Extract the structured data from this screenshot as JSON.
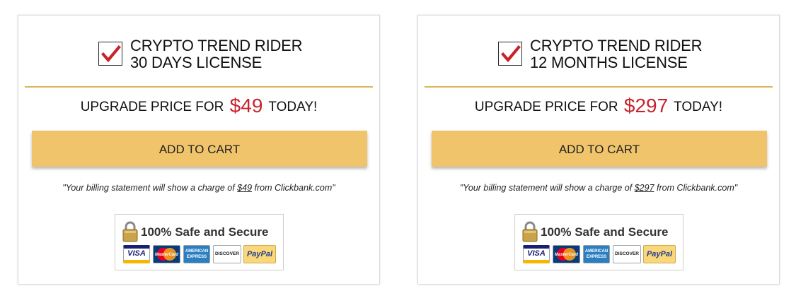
{
  "colors": {
    "accent_gold": "#d9b45c",
    "button_bg": "#f0c46b",
    "price_red": "#c8232c",
    "check_red": "#c8232c"
  },
  "offers": [
    {
      "title_line1": "CRYPTO TREND RIDER",
      "title_line2": "30 DAYS LICENSE",
      "checked": true,
      "price_prefix": "UPGRADE PRICE FOR",
      "price": "$49",
      "price_suffix": "TODAY!",
      "cart_label": "ADD TO CART",
      "billing_prefix": "\"Your billing statement will show a charge of ",
      "billing_amount": "$49",
      "billing_suffix": " from Clickbank.com\"",
      "secure_label": "100% Safe and Secure",
      "payment_methods": [
        "VISA",
        "MasterCard",
        "AMERICAN EXPRESS",
        "DISCOVER",
        "PayPal"
      ]
    },
    {
      "title_line1": "CRYPTO TREND RIDER",
      "title_line2": "12 MONTHS LICENSE",
      "checked": true,
      "price_prefix": "UPGRADE PRICE FOR",
      "price": "$297",
      "price_suffix": "TODAY!",
      "cart_label": "ADD TO CART",
      "billing_prefix": "\"Your billing statement will show a charge of ",
      "billing_amount": "$297",
      "billing_suffix": " from Clickbank.com\"",
      "secure_label": "100% Safe and Secure",
      "payment_methods": [
        "VISA",
        "MasterCard",
        "AMERICAN EXPRESS",
        "DISCOVER",
        "PayPal"
      ]
    }
  ]
}
